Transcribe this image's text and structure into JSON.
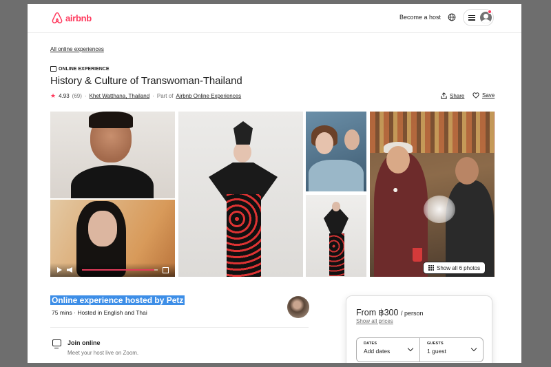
{
  "header": {
    "logo_text": "airbnb",
    "become_host": "Become a host",
    "brand_color": "#ff385c"
  },
  "breadcrumb": {
    "all_experiences": "All online experiences"
  },
  "listing": {
    "badge": "ONLINE EXPERIENCE",
    "title": "History & Culture of Transwoman-Thailand",
    "rating": "4.93",
    "reviews": "(69)",
    "location": "Khet Watthana, Thailand",
    "part_of_prefix": "Part of",
    "part_of_link": "Airbnb Online Experiences",
    "share_label": "Share",
    "save_label": "Save",
    "show_all_photos": "Show all 6 photos",
    "video_progress": 0.95
  },
  "host": {
    "hosted_by": "Online experience hosted by Petz",
    "duration": "75 mins · Hosted in English and Thai"
  },
  "features": [
    {
      "title": "Join online",
      "subtitle": "Meet your host live on Zoom.",
      "icon": "screen-cast-icon"
    }
  ],
  "booking": {
    "price": "From ฿300",
    "per": "/ person",
    "show_all_prices": "Show all prices",
    "dates_label": "DATES",
    "dates_value": "Add dates",
    "guests_label": "GUESTS",
    "guests_value": "1 guest"
  }
}
